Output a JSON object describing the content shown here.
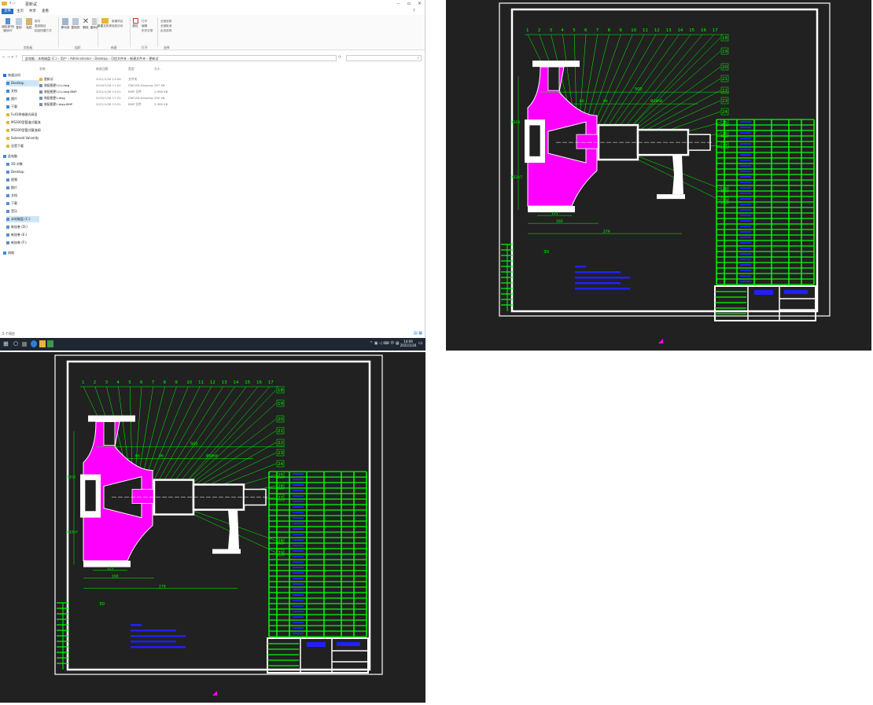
{
  "window": {
    "title": "更新试"
  },
  "ribbon_tabs": [
    "文件",
    "主页",
    "共享",
    "查看"
  ],
  "ribbon": {
    "clipboard": {
      "pin": "固定到'快速访问'",
      "copy": "复制",
      "paste": "粘贴",
      "cut": "剪切",
      "copy_path": "复制路径",
      "paste_shortcut": "粘贴快捷方式",
      "label": "剪贴板"
    },
    "organize": {
      "move_to": "移动到",
      "copy_to": "复制到",
      "delete": "删除",
      "rename": "重命名",
      "label": "组织"
    },
    "new": {
      "new_folder": "新建文件夹",
      "new_item": "新建项目",
      "easy_access": "轻松访问",
      "label": "新建"
    },
    "open": {
      "properties": "属性",
      "open": "打开",
      "edit": "编辑",
      "history": "历史记录",
      "label": "打开"
    },
    "select": {
      "select_all": "全部选择",
      "select_none": "全部取消",
      "invert": "反向选择",
      "label": "选择"
    }
  },
  "address": {
    "path": [
      "此电脑",
      "本地磁盘 (C:)",
      "用户",
      "Administrator",
      "Desktop",
      "可信文件夹",
      "新建文件夹",
      "更新试"
    ]
  },
  "nav": {
    "quick_access": "快速访问",
    "items": [
      "Desktop",
      "文档",
      "图片",
      "下载",
      "Full1例电磁式阀设",
      "MS300型管道式截流",
      "MS300型管式截流阀",
      "Solenoid Valve(电",
      "总是下载"
    ],
    "this_pc": "此电脑",
    "pc_items": [
      "3D 对象",
      "Desktop",
      "视频",
      "图片",
      "文档",
      "下载",
      "音乐",
      "本地磁盘 (C:)",
      "新加卷 (D:)",
      "新加卷 (E:)",
      "新加卷 (F:)"
    ],
    "network": "网络"
  },
  "files": {
    "headers": {
      "name": "名称",
      "date": "修改日期",
      "type": "类型",
      "size": "大小"
    },
    "rows": [
      {
        "name": "更新试",
        "date": "2021/1/26 13:06",
        "type": "文件夹",
        "size": ""
      },
      {
        "name": "装配图更1(1).dwg",
        "date": "2019/7/18 17:02",
        "type": "ZWCAD.Drawing",
        "size": "287 KB"
      },
      {
        "name": "装配图更1(1).dwg.BMP",
        "date": "2021/1/26 13:51",
        "type": "BMP 文件",
        "size": "2,998 KB"
      },
      {
        "name": "装配图更1.dwg",
        "date": "2019/7/26 17:32",
        "type": "ZWCAD.Drawing",
        "size": "290 KB"
      },
      {
        "name": "装配图更1.dwg.BMP",
        "date": "2021/1/26 13:51",
        "type": "BMP 文件",
        "size": "2,998 KB"
      }
    ]
  },
  "status": {
    "count": "5 个项目"
  },
  "taskbar": {
    "time": "14:09",
    "date": "2021/1/26"
  },
  "cad": {
    "top_numbers": [
      "1",
      "2",
      "3",
      "4",
      "5",
      "6",
      "7",
      "8",
      "9",
      "10",
      "11",
      "12",
      "13",
      "14",
      "15",
      "16",
      "17"
    ],
    "right_numbers": [
      "18",
      "19",
      "20",
      "21",
      "22",
      "23",
      "24",
      "25",
      "26",
      "27",
      "28",
      "29"
    ],
    "left_number": "30",
    "dims": {
      "d1": "500",
      "d2": "66",
      "d3": "96",
      "d4": "Ø38h8",
      "d5": "Ø310",
      "d6": "Ø32h7",
      "d7": "125",
      "d8": "160",
      "d9": "279"
    }
  },
  "colors": {
    "accent": "#1a73d4",
    "cad_bg": "#212121",
    "cad_green": "#00ff00",
    "cad_magenta": "#ff00ff",
    "cad_white": "#ffffff",
    "cad_blue": "#2020ff"
  }
}
